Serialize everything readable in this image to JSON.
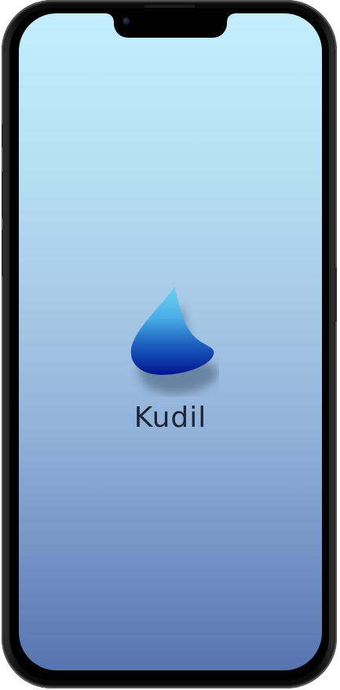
{
  "splash": {
    "app_name": "Kudil",
    "logo": "water-drop-logo"
  },
  "colors": {
    "background_top": "#c4eefd",
    "background_bottom": "#5874b0",
    "logo_light": "#5cc3ef",
    "logo_dark": "#011590",
    "text": "#1f2534"
  }
}
